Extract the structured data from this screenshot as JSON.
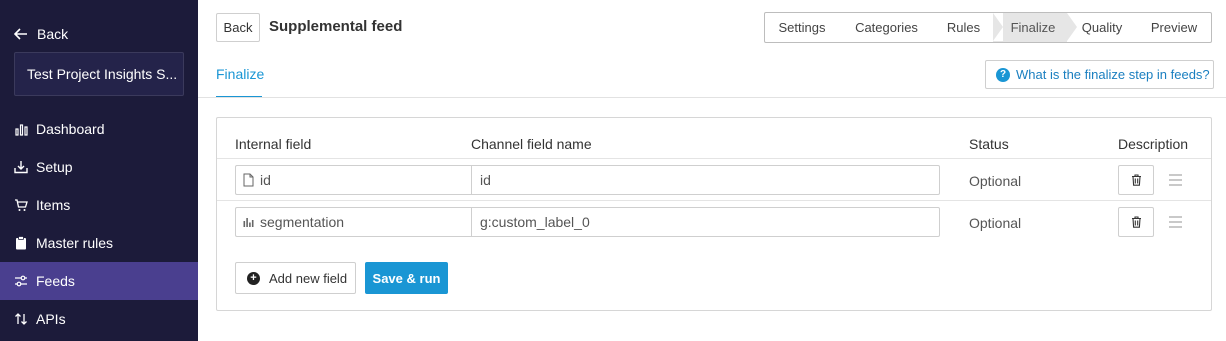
{
  "sidebar": {
    "back_label": "Back",
    "project_name": "Test Project Insights S...",
    "items": [
      {
        "label": "Dashboard",
        "icon": "bar-chart-icon",
        "active": false
      },
      {
        "label": "Setup",
        "icon": "download-tray-icon",
        "active": false
      },
      {
        "label": "Items",
        "icon": "cart-icon",
        "active": false
      },
      {
        "label": "Master rules",
        "icon": "clipboard-icon",
        "active": false
      },
      {
        "label": "Feeds",
        "icon": "sliders-icon",
        "active": true
      },
      {
        "label": "APIs",
        "icon": "sort-arrows-icon",
        "active": false
      }
    ],
    "colors": {
      "background": "#1c1b3a",
      "active_item": "#4a3f8f"
    }
  },
  "header": {
    "back_label": "Back",
    "title": "Supplemental feed",
    "steps": [
      {
        "label": "Settings",
        "active": false
      },
      {
        "label": "Categories",
        "active": false
      },
      {
        "label": "Rules",
        "active": false
      },
      {
        "label": "Finalize",
        "active": true
      },
      {
        "label": "Quality",
        "active": false
      },
      {
        "label": "Preview",
        "active": false
      }
    ]
  },
  "subheader": {
    "tab_label": "Finalize",
    "help_label": "What is the finalize step in feeds?",
    "help_icon": "question-circle-icon"
  },
  "table": {
    "columns": {
      "internal_field": "Internal field",
      "channel_field": "Channel field name",
      "status": "Status",
      "description": "Description"
    },
    "rows": [
      {
        "internal_field": "id",
        "internal_icon": "document-icon",
        "channel_field": "id",
        "status": "Optional"
      },
      {
        "internal_field": "segmentation",
        "internal_icon": "bar-chart-icon",
        "channel_field": "g:custom_label_0",
        "status": "Optional"
      }
    ]
  },
  "actions": {
    "add_label": "Add new field",
    "save_label": "Save & run"
  },
  "colors": {
    "accent": "#1a96d4"
  }
}
